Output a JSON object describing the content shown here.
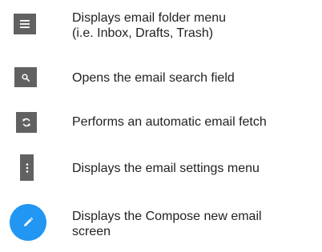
{
  "legend": {
    "items": [
      {
        "icon": "menu-icon",
        "lines": [
          "Displays email folder menu",
          "(i.e. Inbox, Drafts, Trash)"
        ]
      },
      {
        "icon": "search-icon",
        "lines": [
          "Opens the email search field"
        ]
      },
      {
        "icon": "refresh-icon",
        "lines": [
          "Performs an automatic email fetch"
        ]
      },
      {
        "icon": "more-vertical-icon",
        "lines": [
          "Displays the email settings menu"
        ]
      },
      {
        "icon": "pencil-icon",
        "lines": [
          "Displays the Compose new email",
          "screen"
        ]
      }
    ]
  },
  "colors": {
    "icon_tile": "#616161",
    "compose_button": "#2196F3",
    "icon_glyph": "#ffffff",
    "text": "#222222"
  }
}
